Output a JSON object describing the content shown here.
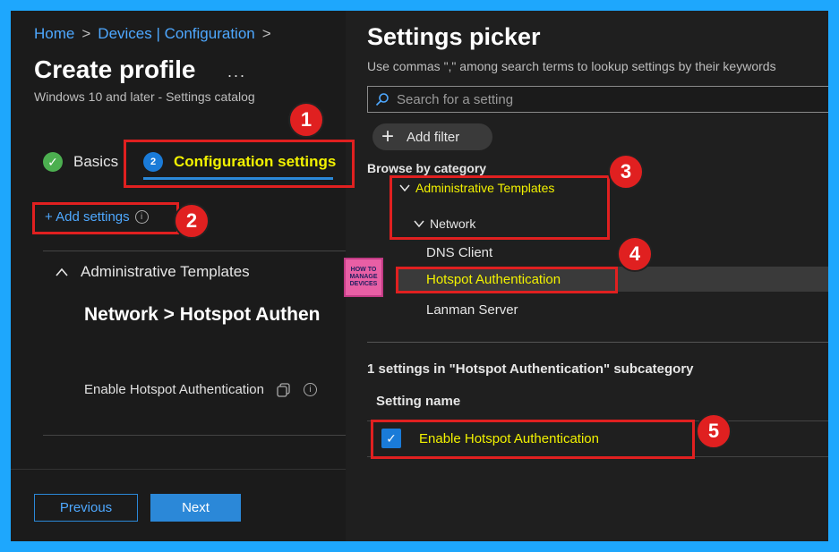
{
  "left": {
    "breadcrumb": [
      "Home",
      "Devices | Configuration"
    ],
    "title": "Create profile",
    "ellipsis": "...",
    "subtitle": "Windows 10 and later - Settings catalog",
    "tabs": [
      {
        "label": "Basics",
        "state": "complete"
      },
      {
        "label": "Configuration settings",
        "number": "2",
        "state": "active"
      }
    ],
    "add_settings": "+ Add settings",
    "section_heading": "Administrative Templates",
    "path_title": "Network > Hotspot Authen",
    "setting_label": "Enable Hotspot Authentication",
    "buttons": {
      "previous": "Previous",
      "next": "Next"
    }
  },
  "right": {
    "title": "Settings picker",
    "subtitle": "Use commas \",\" among search terms to lookup settings by their keywords",
    "search_placeholder": "Search for a setting",
    "add_filter": "Add filter",
    "browse_label": "Browse by category",
    "categories": {
      "level1": "Administrative Templates",
      "level2": "Network",
      "subitems": [
        "DNS Client",
        "Hotspot Authentication",
        "Lanman Server"
      ]
    },
    "count_text": "1 settings in \"Hotspot Authentication\" subcategory",
    "column_header": "Setting name",
    "setting_row": "Enable Hotspot Authentication"
  },
  "annotations": [
    "1",
    "2",
    "3",
    "4",
    "5"
  ],
  "logo_text": [
    "HOW TO",
    "MANAGE",
    "DEVICES"
  ],
  "colors": {
    "accent": "#2b88d8",
    "highlight": "#f2f200",
    "annotation": "#e02020",
    "frame": "#1ea7fd"
  }
}
